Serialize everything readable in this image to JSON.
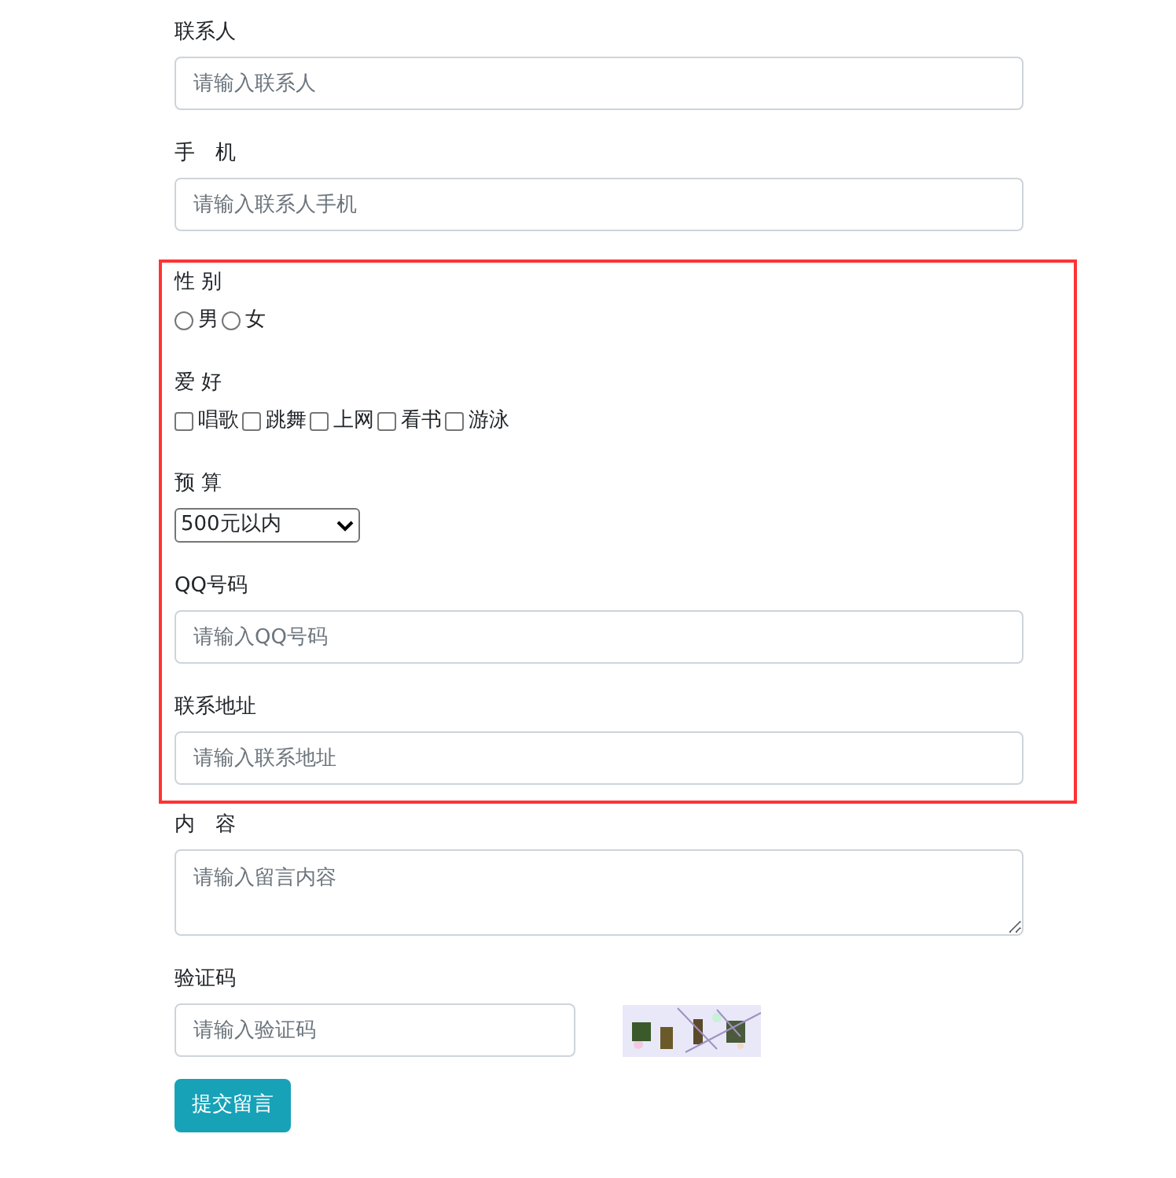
{
  "fields": [
    {
      "kind": "text",
      "label": "联系人",
      "placeholder": "请输入联系人",
      "highlighted": false
    },
    {
      "kind": "text",
      "label": "手　机",
      "placeholder": "请输入联系人手机",
      "highlighted": false
    },
    {
      "kind": "radio",
      "label": "性 别",
      "highlighted": true,
      "options": [
        {
          "label": "男",
          "selected": false
        },
        {
          "label": "女",
          "selected": false
        }
      ]
    },
    {
      "kind": "checkbox",
      "label": "爱 好",
      "highlighted": true,
      "options": [
        {
          "label": "唱歌",
          "checked": false
        },
        {
          "label": "跳舞",
          "checked": false
        },
        {
          "label": "上网",
          "checked": false
        },
        {
          "label": "看书",
          "checked": false
        },
        {
          "label": "游泳",
          "checked": false
        }
      ]
    },
    {
      "kind": "select",
      "label": "预 算",
      "value": "500元以内",
      "highlighted": true
    },
    {
      "kind": "text",
      "label": "QQ号码",
      "placeholder": "请输入QQ号码",
      "highlighted": true
    },
    {
      "kind": "text",
      "label": "联系地址",
      "placeholder": "请输入联系地址",
      "highlighted": true
    },
    {
      "kind": "textarea",
      "label": "内　容",
      "placeholder": "请输入留言内容",
      "highlighted": false
    },
    {
      "kind": "captcha",
      "label": "验证码",
      "placeholder": "请输入验证码",
      "highlighted": false
    }
  ],
  "submit": {
    "label": "提交留言"
  }
}
